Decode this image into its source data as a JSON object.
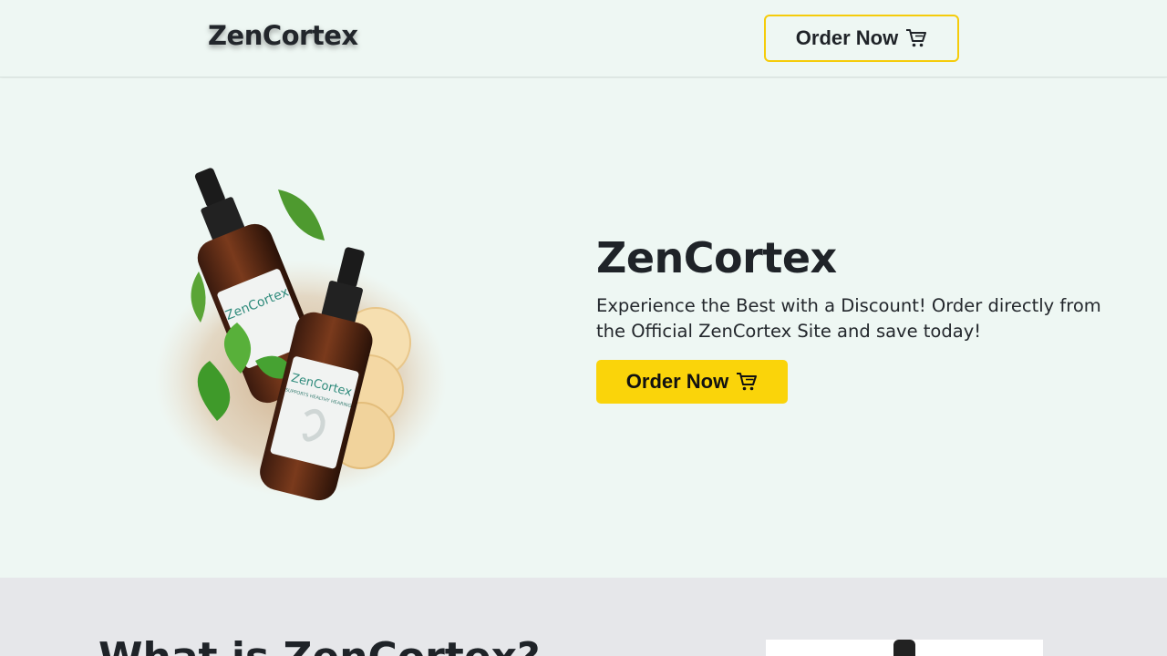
{
  "header": {
    "brand": "ZenCortex",
    "order_label": "Order Now",
    "cart_icon": "cart-icon"
  },
  "hero": {
    "title": "ZenCortex",
    "description": "Experience the Best with a Discount! Order directly from the Official ZenCortex Site and save today!",
    "order_label": "Order Now",
    "product_image": {
      "brand_label": "ZenCortex",
      "sublabel": "SUPPORTS HEALTHY HEARING"
    }
  },
  "about": {
    "heading": "What is ZenCortex?"
  },
  "colors": {
    "background": "#eef7f3",
    "accent": "#fad40a",
    "section_alt": "#e6e7ea",
    "text": "#1f2328"
  }
}
